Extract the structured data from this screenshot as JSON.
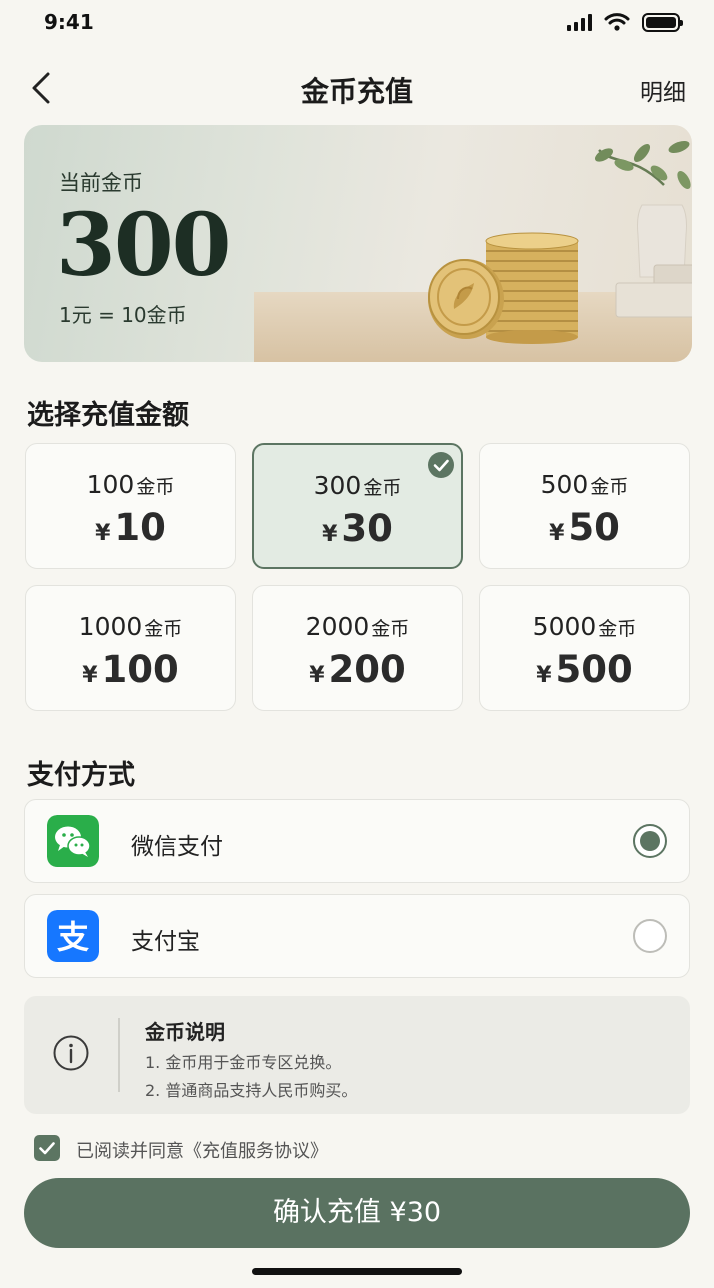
{
  "status_bar": {
    "time": "9:41"
  },
  "nav": {
    "title": "金币充值",
    "detail_label": "明细"
  },
  "balance": {
    "label": "当前金币",
    "value": "300",
    "rate": "1元 = 10金币"
  },
  "amount_section": {
    "title": "选择充值金额",
    "options": [
      {
        "coins": "100",
        "unit": "金币",
        "currency": "¥",
        "price": "10",
        "selected": false
      },
      {
        "coins": "300",
        "unit": "金币",
        "currency": "¥",
        "price": "30",
        "selected": true
      },
      {
        "coins": "500",
        "unit": "金币",
        "currency": "¥",
        "price": "50",
        "selected": false
      },
      {
        "coins": "1000",
        "unit": "金币",
        "currency": "¥",
        "price": "100",
        "selected": false
      },
      {
        "coins": "2000",
        "unit": "金币",
        "currency": "¥",
        "price": "200",
        "selected": false
      },
      {
        "coins": "5000",
        "unit": "金币",
        "currency": "¥",
        "price": "500",
        "selected": false
      }
    ]
  },
  "payment_section": {
    "title": "支付方式",
    "methods": [
      {
        "label": "微信支付",
        "icon": "wechat-pay-icon",
        "selected": true
      },
      {
        "label": "支付宝",
        "icon": "alipay-icon",
        "selected": false
      }
    ]
  },
  "info": {
    "title": "金币说明",
    "lines": [
      "1. 金币用于金币专区兑换。",
      "2. 普通商品支持人民币购买。"
    ]
  },
  "agreement": {
    "prefix": "已阅读并同意",
    "link": "《充值服务协议》",
    "checked": true
  },
  "confirm": {
    "label": "确认充值 ¥30"
  },
  "colors": {
    "accent": "#5a7261",
    "wechat": "#2aae4a",
    "alipay": "#1677ff",
    "background": "#f7f6f1"
  }
}
